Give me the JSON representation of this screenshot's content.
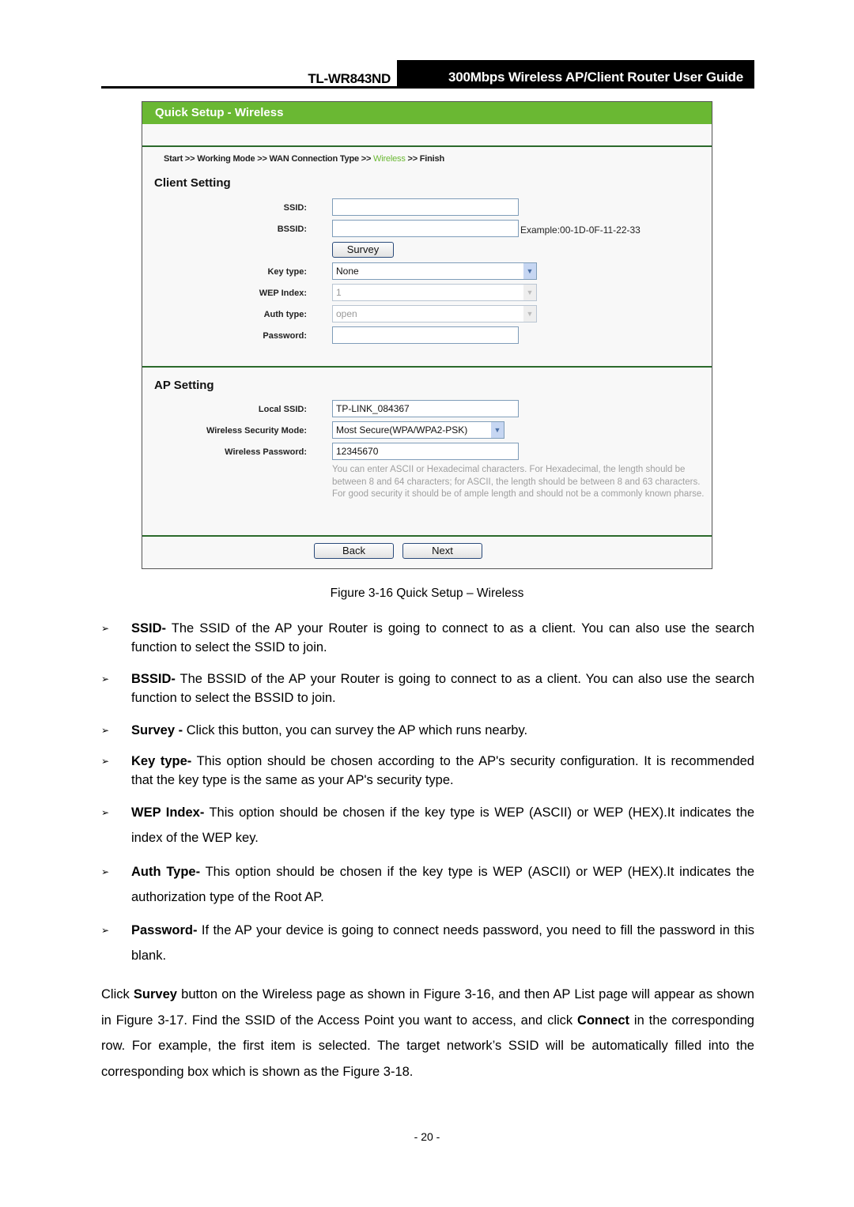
{
  "header": {
    "model": "TL-WR843ND",
    "guide_title": "300Mbps Wireless AP/Client Router User Guide"
  },
  "screenshot": {
    "title": "Quick Setup - Wireless",
    "breadcrumb": {
      "before": "Start >> Working Mode >> WAN Connection Type >> ",
      "active": "Wireless",
      "after": " >> Finish"
    },
    "client_setting": {
      "title": "Client Setting",
      "ssid_label": "SSID:",
      "ssid_value": "",
      "bssid_label": "BSSID:",
      "bssid_value": "",
      "bssid_example": "Example:00-1D-0F-11-22-33",
      "survey_button": "Survey",
      "key_type_label": "Key type:",
      "key_type_value": "None",
      "wep_index_label": "WEP Index:",
      "wep_index_value": "1",
      "auth_type_label": "Auth type:",
      "auth_type_value": "open",
      "password_label": "Password:",
      "password_value": ""
    },
    "ap_setting": {
      "title": "AP Setting",
      "local_ssid_label": "Local SSID:",
      "local_ssid_value": "TP-LINK_084367",
      "security_mode_label": "Wireless Security Mode:",
      "security_mode_value": "Most Secure(WPA/WPA2-PSK)",
      "wireless_password_label": "Wireless Password:",
      "wireless_password_value": "12345670",
      "hint": "You can enter ASCII or Hexadecimal characters. For Hexadecimal, the length should be between 8 and 64 characters; for ASCII, the length should be between 8 and 63 characters. For good security it should be of ample length and should not be a commonly known pharse."
    },
    "back_button": "Back",
    "next_button": "Next",
    "accent_color": "#6ab833"
  },
  "caption": "Figure 3-16 Quick Setup – Wireless",
  "bullets": [
    {
      "term": "SSID-",
      "text": " The SSID of the AP your Router is going to connect to as a client. You can also use the search function to select the SSID to join."
    },
    {
      "term": "BSSID-",
      "text": " The BSSID of the AP your Router is going to connect to as a client. You can also use the search function to select the BSSID to join."
    },
    {
      "term": "Survey -",
      "text": " Click this button, you can survey the AP which runs nearby."
    },
    {
      "term": "Key type-",
      "text": " This option should be chosen according to the AP's security configuration. It is recommended that the key type is the same as your AP's security type."
    },
    {
      "term": "WEP Index-",
      "text": " This option should be chosen if the key type is WEP (ASCII) or WEP (HEX).It indicates the index of the WEP key."
    },
    {
      "term": "Auth Type-",
      "text": " This option should be chosen if the key type is WEP (ASCII) or WEP (HEX).It indicates the authorization type of the Root AP."
    },
    {
      "term": "Password-",
      "text": " If the AP your device is going to connect needs password, you need to fill the password in this blank."
    }
  ],
  "paragraph": {
    "p1": "Click ",
    "b1": "Survey",
    "p2": " button on the Wireless page as shown in Figure 3-16, and then AP List page will appear as shown in Figure 3-17. Find the SSID of the Access Point you want to access, and click ",
    "b2": "Connect",
    "p3": " in the corresponding row. For example, the first item is selected. The target network’s SSID will be automatically filled into the corresponding box which is shown as the Figure 3-18."
  },
  "page_number": "- 20 -",
  "bullet_glyph": "➢"
}
